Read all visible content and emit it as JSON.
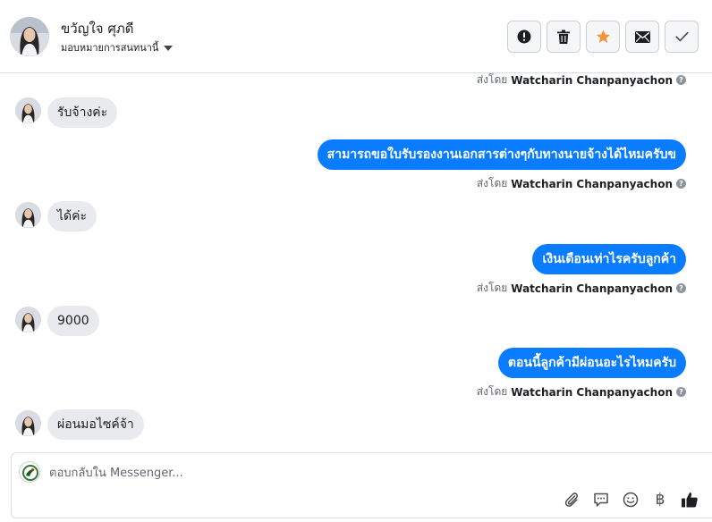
{
  "header": {
    "contact_name": "ขวัญใจ ศุภดี",
    "assign_label": "มอบหมายการสนทนานี้",
    "actions": [
      {
        "name": "report-spam",
        "icon": "alert-icon"
      },
      {
        "name": "delete",
        "icon": "trash-icon"
      },
      {
        "name": "star",
        "icon": "star-icon",
        "color": "#f7923b"
      },
      {
        "name": "mark-unread",
        "icon": "mail-icon"
      },
      {
        "name": "mark-done",
        "icon": "check-icon"
      }
    ]
  },
  "thread": {
    "sent_by_prefix": "ส่งโดย",
    "messages": [
      {
        "type": "meta",
        "sender": "Watcharin Chanpanyachon"
      },
      {
        "type": "in",
        "text": "รับจ้างค่ะ"
      },
      {
        "type": "out",
        "text": "สามารถขอใบรับรองงานเอกสารต่างๆกับทางนายจ้างได้ไหมครับข"
      },
      {
        "type": "meta",
        "sender": "Watcharin Chanpanyachon"
      },
      {
        "type": "in",
        "text": "ได้ค่ะ"
      },
      {
        "type": "out",
        "text": "เงินเดือนเท่าไรครับลูกค้า"
      },
      {
        "type": "meta",
        "sender": "Watcharin Chanpanyachon"
      },
      {
        "type": "in",
        "text": "9000"
      },
      {
        "type": "out",
        "text": "ตอนนี้ลูกค้ามีผ่อนอะไรไหมครับ"
      },
      {
        "type": "meta",
        "sender": "Watcharin Chanpanyachon"
      },
      {
        "type": "in",
        "text": "ผ่อนมอไซค์จ้า"
      }
    ]
  },
  "composer": {
    "placeholder": "ตอบกลับใน Messenger...",
    "tools": [
      "paperclip-icon",
      "saved-reply-icon",
      "emoji-icon",
      "baht-icon",
      "thumbs-up-icon"
    ],
    "baht_symbol": "฿",
    "accent_color": "#0a7cff"
  }
}
